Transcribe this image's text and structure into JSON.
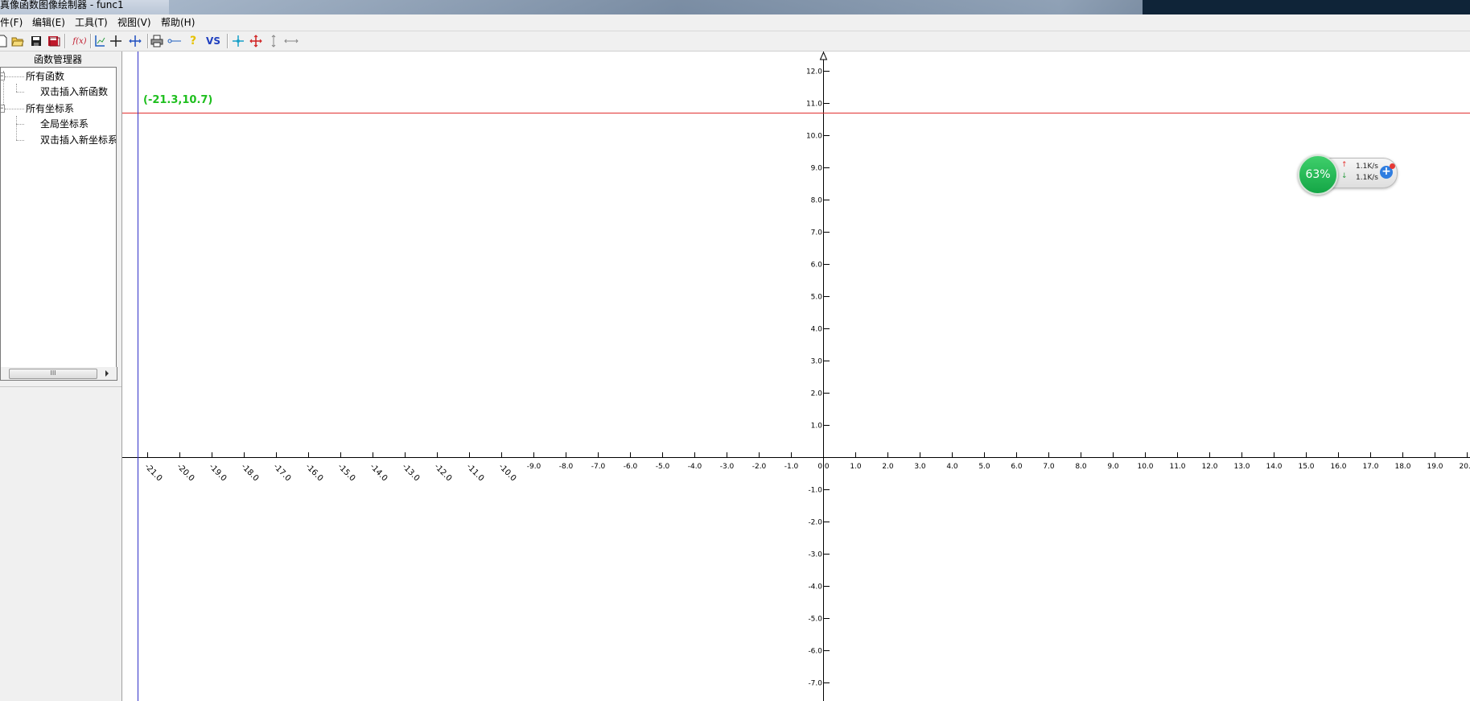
{
  "window": {
    "title": "真像函数图像绘制器 - func1"
  },
  "menu": {
    "items": [
      "件(F)",
      "编辑(E)",
      "工具(T)",
      "视图(V)",
      "帮助(H)"
    ]
  },
  "toolbar": {
    "buttons": [
      {
        "name": "new-file-icon"
      },
      {
        "name": "open-folder-icon"
      },
      {
        "name": "save-icon"
      },
      {
        "name": "save-all-icon"
      },
      {
        "name": "insert-function-icon",
        "text": "f(x)"
      },
      {
        "name": "axis-icon"
      },
      {
        "name": "crosshair-icon"
      },
      {
        "name": "coordinate-move-icon"
      },
      {
        "name": "print-icon"
      },
      {
        "name": "link-icon"
      },
      {
        "name": "help-icon"
      },
      {
        "name": "versus-icon",
        "text": "VS"
      },
      {
        "name": "point-tool-icon"
      },
      {
        "name": "move-tool-icon"
      },
      {
        "name": "vertical-resize-icon"
      },
      {
        "name": "horizontal-resize-icon"
      }
    ]
  },
  "panel": {
    "title": "函数管理器",
    "tree": {
      "functions_label": "所有函数",
      "insert_function": "双击插入新函数",
      "systems_label": "所有坐标系",
      "global_system": "全局坐标系",
      "insert_system": "双击插入新坐标系"
    },
    "scroll_thumb": "III"
  },
  "plot": {
    "cursor_readout": "(-21.3,10.7)",
    "axis_color": "#000000",
    "cursor_h_color": "#e03030",
    "cursor_v_color": "#3030c8",
    "cursor": {
      "x": -21.3,
      "y": 10.7
    },
    "x_range": [
      -21.5,
      20.8
    ],
    "y_range": [
      -7.5,
      12.5
    ],
    "x_ticks": [
      -21,
      -20,
      -19,
      -18,
      -17,
      -16,
      -15,
      -14,
      -13,
      -12,
      -11,
      -10,
      -9,
      -8,
      -7,
      -6,
      -5,
      -4,
      -3,
      -2,
      -1,
      0,
      1,
      2,
      3,
      4,
      5,
      6,
      7,
      8,
      9,
      10,
      11,
      12,
      13,
      14,
      15,
      16,
      17,
      18,
      19,
      20
    ],
    "y_ticks": [
      12,
      11,
      10,
      9,
      8,
      7,
      6,
      5,
      4,
      3,
      2,
      1,
      -1,
      -2,
      -3,
      -4,
      -5,
      -6,
      -7
    ]
  },
  "net_monitor": {
    "percent": "63%",
    "upload": "1.1K/s",
    "download": "1.1K/s"
  }
}
